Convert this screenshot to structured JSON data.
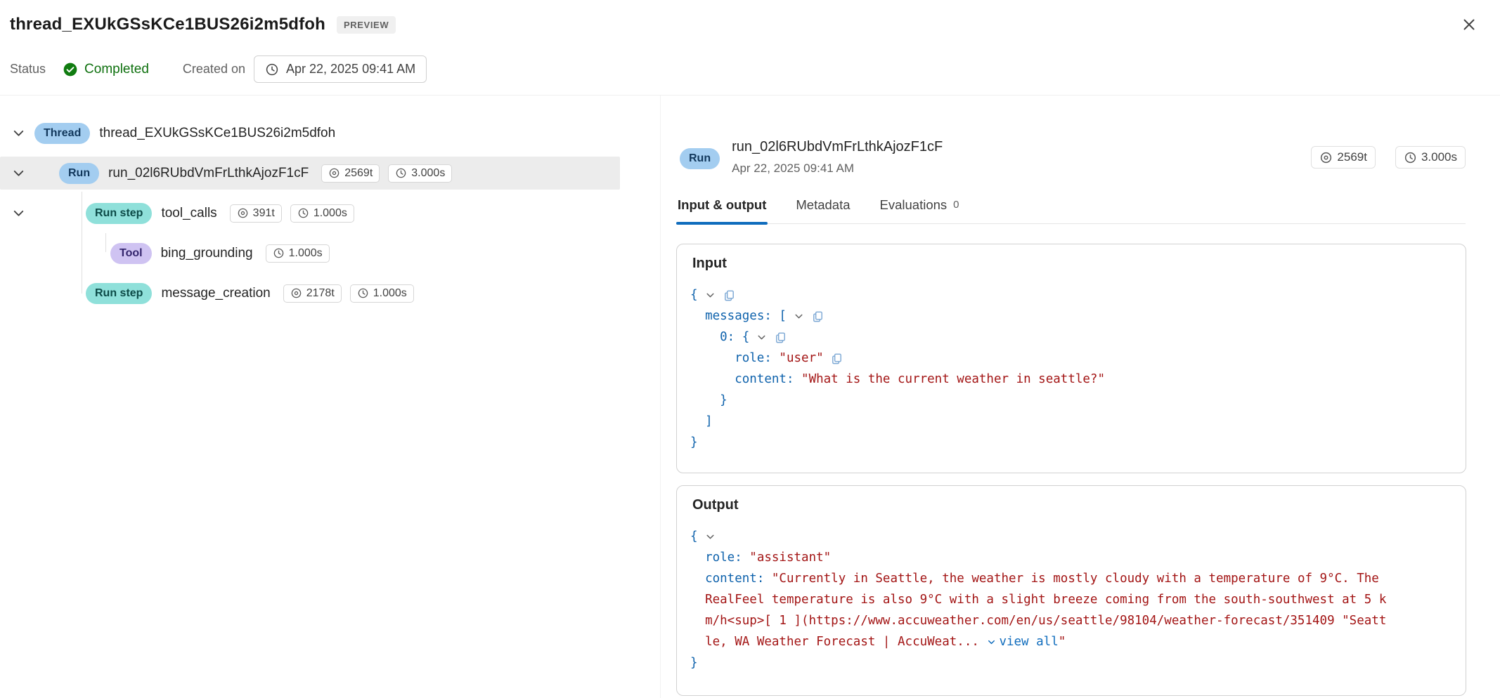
{
  "colors": {
    "accent": "#0f6cbd",
    "status_completed_green": "#107c10",
    "json_key_blue": "#0e62ac",
    "json_string_red": "#a31515"
  },
  "titlebar": {
    "title": "thread_EXUkGSsKCe1BUS26i2m5dfoh",
    "preview_badge": "PREVIEW"
  },
  "statusbar": {
    "status_label": "Status",
    "status_value": "Completed",
    "created_label": "Created on",
    "created_value": "Apr 22, 2025 09:41 AM"
  },
  "tree": {
    "thread": {
      "badge": "Thread",
      "label": "thread_EXUkGSsKCe1BUS26i2m5dfoh"
    },
    "run": {
      "badge": "Run",
      "label": "run_02l6RUbdVmFrLthkAjozF1cF",
      "tokens": "2569t",
      "duration": "3.000s"
    },
    "tool_calls": {
      "badge": "Run step",
      "label": "tool_calls",
      "tokens": "391t",
      "duration": "1.000s"
    },
    "tool": {
      "badge": "Tool",
      "label": "bing_grounding",
      "duration": "1.000s"
    },
    "message_creation": {
      "badge": "Run step",
      "label": "message_creation",
      "tokens": "2178t",
      "duration": "1.000s"
    }
  },
  "detail": {
    "badge": "Run",
    "title": "run_02l6RUbdVmFrLthkAjozF1cF",
    "date": "Apr 22, 2025 09:41 AM",
    "tokens": "2569t",
    "duration": "3.000s",
    "tabs": {
      "input_output": "Input & output",
      "metadata": "Metadata",
      "evaluations": "Evaluations",
      "evaluations_count": "0"
    },
    "input": {
      "heading": "Input",
      "line1_brace": "{",
      "line2_text": "messages: [",
      "line3_text": "0: {",
      "line4_key": "role: ",
      "line4_value": "\"user\"",
      "line5_key": "content: ",
      "line5_value": "\"What is the current weather in seattle?\"",
      "line6_brace": "}",
      "line7_bracket": "]",
      "line8_brace": "}"
    },
    "output": {
      "heading": "Output",
      "line1_brace": "{",
      "role_key": "role: ",
      "role_value": "\"assistant\"",
      "content_key": "content: ",
      "content_line1": "\"Currently in Seattle, the weather is mostly cloudy with a temperature of 9°C. The",
      "content_line2": "RealFeel temperature is also 9°C with a slight breeze coming from the south-southwest at 5 k",
      "content_line3": "m/h<sup>[ 1 ](https://www.accuweather.com/en/us/seattle/98104/weather-forecast/351409 \"Seatt",
      "content_line4": "le, WA Weather Forecast | AccuWeat... ",
      "view_all": "view all",
      "close_quote": "\"",
      "close_brace": "}"
    }
  }
}
